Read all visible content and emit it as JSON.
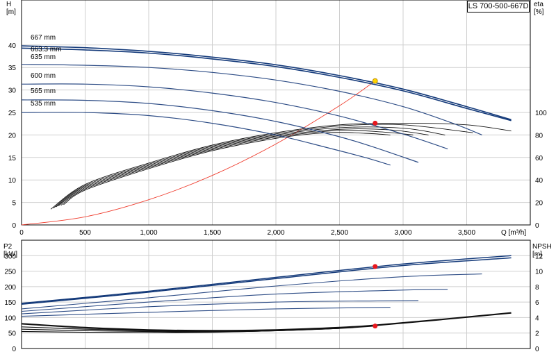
{
  "model": "LS 700-500-667D",
  "colors": {
    "head_curve": "#2e4d86",
    "head_curve_highlight": "#143a7a",
    "system_curve": "#ef3b2c",
    "duty_point": "#e8171e",
    "duty_point_yellow": "#ffd400",
    "eff_npsh_curve": "#111111",
    "grid": "#cfcfcf"
  },
  "chart_data": [
    {
      "type": "line",
      "x_label": "Q [m³/h]",
      "x_ticks": [
        "0",
        "500",
        "1,000",
        "1,500",
        "2,000",
        "2,500",
        "3,000",
        "3,500"
      ],
      "x_range": [
        0,
        4000
      ],
      "y_label": "H\n[m]",
      "y_ticks": [
        0,
        5,
        10,
        15,
        20,
        25,
        30,
        35,
        40
      ],
      "y_range": [
        0,
        50
      ],
      "y2_label": "eta\n[%]",
      "y2_ticks": [
        0,
        20,
        40,
        60,
        80,
        100
      ],
      "y2_range": [
        0,
        200
      ],
      "grid": true,
      "head_curves": [
        {
          "name": "667 mm",
          "x": [
            0,
            500,
            1000,
            1500,
            2000,
            2500,
            3000,
            3500,
            3850
          ],
          "y": [
            39.8,
            39.4,
            38.6,
            37.3,
            35.6,
            33.2,
            30.2,
            26.3,
            23.4
          ]
        },
        {
          "name": "663.3 mm",
          "x": [
            0,
            500,
            1000,
            1500,
            2000,
            2500,
            3000,
            3500,
            3850
          ],
          "y": [
            39.3,
            38.9,
            38.2,
            36.9,
            35.2,
            32.8,
            29.8,
            25.9,
            23.2
          ]
        },
        {
          "name": "635 mm",
          "x": [
            0,
            500,
            1000,
            1500,
            2000,
            2500,
            3000,
            3400,
            3620
          ],
          "y": [
            35.7,
            35.5,
            35.0,
            33.9,
            32.2,
            29.7,
            26.3,
            22.5,
            20.0
          ]
        },
        {
          "name": "600 mm",
          "x": [
            0,
            500,
            1000,
            1500,
            2000,
            2500,
            3000,
            3350
          ],
          "y": [
            31.3,
            31.3,
            30.7,
            29.3,
            27.2,
            24.2,
            20.2,
            16.9
          ]
        },
        {
          "name": "565 mm",
          "x": [
            0,
            500,
            1000,
            1500,
            2000,
            2500,
            2800,
            3120
          ],
          "y": [
            27.8,
            27.7,
            27.0,
            25.4,
            23.0,
            19.6,
            17.0,
            13.9
          ]
        },
        {
          "name": "535 mm",
          "x": [
            0,
            500,
            1000,
            1500,
            2000,
            2400,
            2700,
            2900
          ],
          "y": [
            25.0,
            25.0,
            24.3,
            22.6,
            20.0,
            17.2,
            15.0,
            13.3
          ]
        }
      ],
      "efficiency_curves": [
        {
          "x": [
            230,
            500,
            1000,
            1500,
            2000,
            2500,
            3000,
            3500,
            3850
          ],
          "y": [
            14,
            36,
            55,
            71,
            82,
            89,
            90.5,
            89,
            83.5
          ]
        },
        {
          "x": [
            250,
            500,
            1000,
            1500,
            2000,
            2500,
            3000,
            3550
          ],
          "y": [
            15,
            35,
            54,
            70,
            81,
            88,
            89,
            82
          ]
        },
        {
          "x": [
            270,
            500,
            1000,
            1500,
            2000,
            2500,
            3000,
            3330
          ],
          "y": [
            16,
            34,
            53,
            69,
            80,
            86.5,
            86,
            80
          ]
        },
        {
          "x": [
            290,
            500,
            1000,
            1500,
            2000,
            2500,
            2900,
            3200
          ],
          "y": [
            17,
            33,
            52,
            68,
            79,
            85,
            84.5,
            80
          ]
        },
        {
          "x": [
            310,
            500,
            1000,
            1500,
            2000,
            2500,
            2850,
            3080
          ],
          "y": [
            17.5,
            32,
            51,
            67,
            78,
            84,
            82.5,
            80
          ]
        },
        {
          "x": [
            330,
            500,
            1000,
            1500,
            2000,
            2400,
            2700,
            2900
          ],
          "y": [
            18,
            31,
            50,
            66,
            77,
            82,
            81.5,
            80
          ]
        }
      ],
      "system_curve": {
        "x": [
          0,
          500,
          1000,
          1500,
          2000,
          2500,
          2780
        ],
        "y": [
          0,
          1.8,
          5.6,
          11.0,
          18.0,
          26.5,
          32.0
        ]
      },
      "duty_points": [
        {
          "x": 2780,
          "y": 32.0,
          "axis": "H",
          "color": "yellow"
        },
        {
          "x": 2780,
          "y": 90.5,
          "axis": "eta",
          "color": "red"
        }
      ]
    },
    {
      "type": "line",
      "x_range": [
        0,
        4000
      ],
      "y_label": "P2\n[kW]",
      "y_ticks": [
        0,
        50,
        100,
        150,
        200,
        250,
        300
      ],
      "y_range": [
        0,
        350
      ],
      "y2_label": "NPSH\n[m]",
      "y2_ticks": [
        0,
        2,
        4,
        6,
        8,
        10,
        12
      ],
      "y2_range": [
        0,
        14
      ],
      "grid": true,
      "power_curves": [
        {
          "x": [
            0,
            1000,
            2000,
            3000,
            3850
          ],
          "y": [
            146,
            185,
            230,
            273,
            300
          ]
        },
        {
          "x": [
            0,
            1000,
            2000,
            3000,
            3850
          ],
          "y": [
            143,
            182,
            226,
            268,
            293
          ]
        },
        {
          "x": [
            0,
            1000,
            2000,
            3000,
            3620
          ],
          "y": [
            128,
            164,
            202,
            232,
            241
          ]
        },
        {
          "x": [
            0,
            1000,
            2000,
            3000,
            3350
          ],
          "y": [
            120,
            150,
            176,
            189,
            191
          ]
        },
        {
          "x": [
            0,
            1000,
            2000,
            2800,
            3120
          ],
          "y": [
            112,
            135,
            150,
            154,
            155
          ]
        },
        {
          "x": [
            0,
            1000,
            2000,
            2900
          ],
          "y": [
            104,
            117,
            128,
            133
          ]
        }
      ],
      "npsh_curves": [
        {
          "x": [
            0,
            500,
            1000,
            1500,
            2000,
            2500,
            2780,
            3200,
            3850
          ],
          "y": [
            3.2,
            2.7,
            2.4,
            2.3,
            2.4,
            2.7,
            3.0,
            3.6,
            4.6
          ]
        },
        {
          "x": [
            0,
            500,
            1000,
            1500,
            2000,
            2500,
            2780
          ],
          "y": [
            2.8,
            2.5,
            2.3,
            2.2,
            2.3,
            2.6,
            2.9
          ]
        },
        {
          "x": [
            0,
            500,
            1000,
            1500,
            2000,
            2500
          ],
          "y": [
            2.5,
            2.3,
            2.2,
            2.15,
            2.3,
            2.6
          ]
        },
        {
          "x": [
            0,
            500,
            1000,
            1500,
            2000,
            2500
          ],
          "y": [
            2.2,
            2.1,
            2.05,
            2.1,
            2.3,
            2.6
          ]
        }
      ],
      "duty_points": [
        {
          "x": 2780,
          "y": 265,
          "axis": "P2",
          "color": "red"
        },
        {
          "x": 2780,
          "y": 2.9,
          "axis": "NPSH",
          "color": "red"
        }
      ]
    }
  ]
}
